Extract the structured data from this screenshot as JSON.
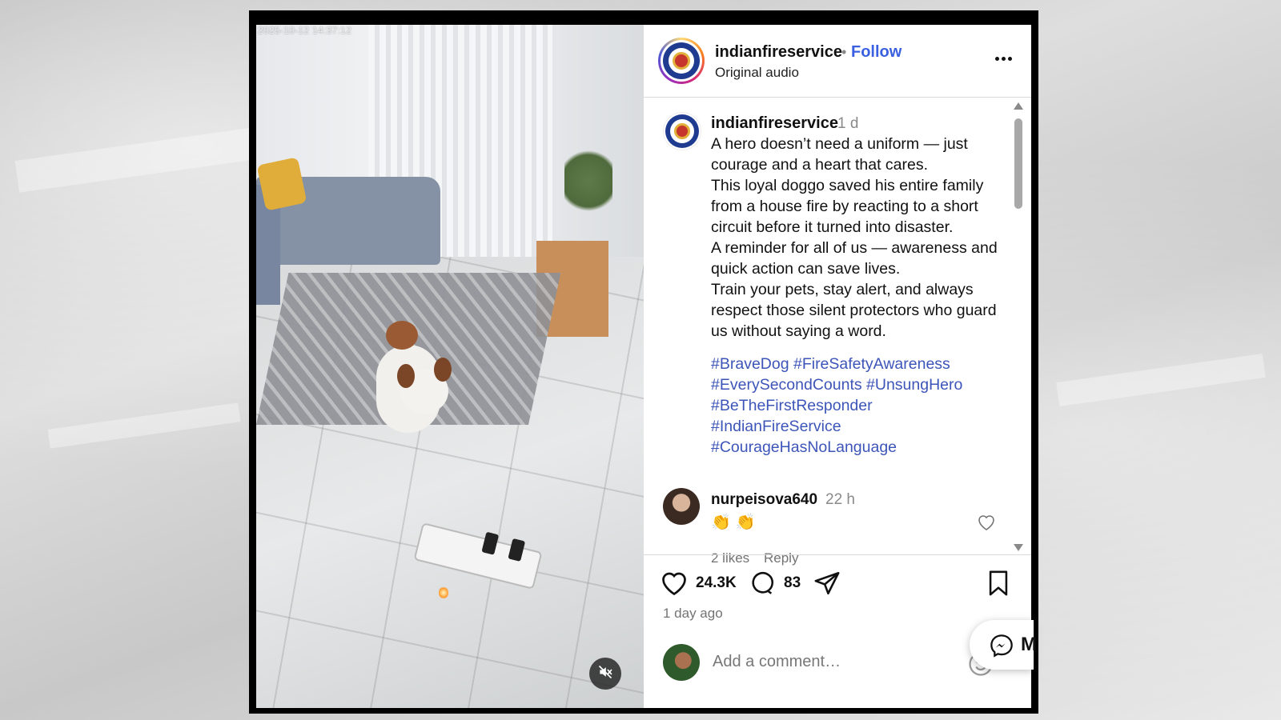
{
  "video": {
    "timestamp": "2025-10-12 14:37:12"
  },
  "header": {
    "username": "indianfireservice",
    "separator": "•",
    "follow_label": "Follow",
    "audio_label": "Original audio"
  },
  "post": {
    "username": "indianfireservice",
    "time": "1 d",
    "caption": [
      "A hero doesn’t need a uniform — just courage and a heart that cares.",
      "This loyal doggo saved his entire family from a house fire by reacting to a short circuit before it turned into disaster.",
      "A reminder for all of us — awareness and quick action can save lives.",
      "Train your pets, stay alert, and always respect those silent protectors who guard us without saying a word."
    ],
    "hashtags": [
      "#BraveDog #FireSafetyAwareness",
      "#EverySecondCounts #UnsungHero",
      "#BeTheFirstResponder",
      "#IndianFireService",
      "#CourageHasNoLanguage"
    ]
  },
  "comment": {
    "username": "nurpeisova640",
    "time": "22 h",
    "text": "👏 👏",
    "likes": "2 likes",
    "reply_label": "Reply"
  },
  "actions": {
    "likes_count": "24.3K",
    "comments_count": "83",
    "posted_ago": "1 day ago"
  },
  "add_comment": {
    "placeholder": "Add a comment…"
  },
  "messenger": {
    "label_partial": "M"
  },
  "colors": {
    "follow_blue": "#3a5fe0",
    "hashtag_blue": "#3d55b8",
    "secondary_text": "#737373"
  },
  "icons": [
    "more-options-icon",
    "heart-icon",
    "comment-icon",
    "share-icon",
    "bookmark-icon",
    "emoji-icon",
    "messenger-icon",
    "mute-icon"
  ]
}
